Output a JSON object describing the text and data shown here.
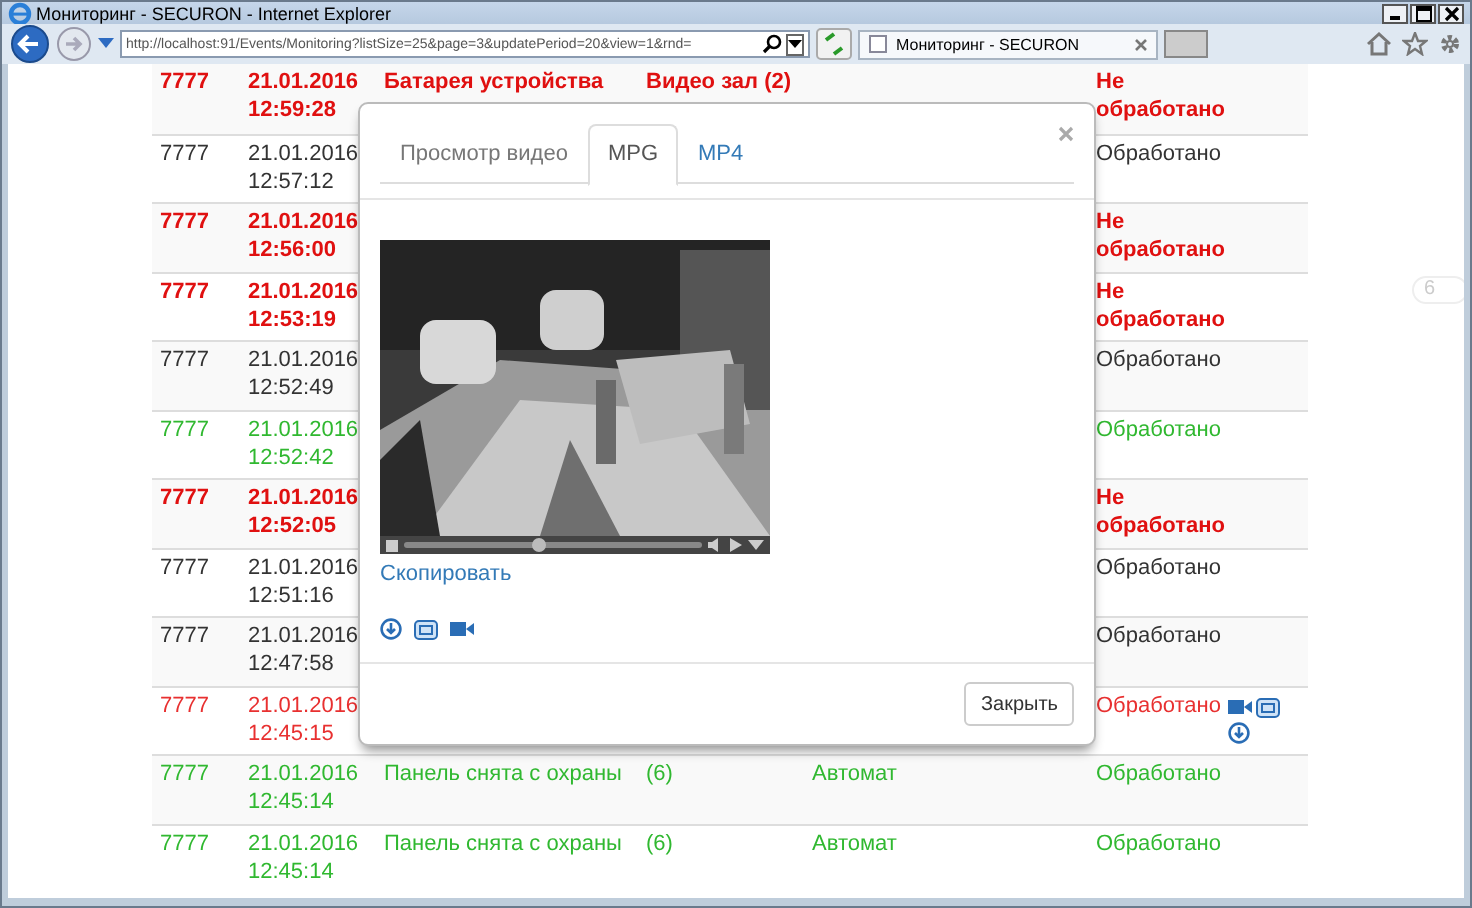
{
  "window": {
    "title": "Мониторинг - SECURON - Internet Explorer"
  },
  "browser": {
    "address": "http://localhost:91/Events/Monitoring?listSize=25&page=3&updatePeriod=20&view=1&rnd=",
    "tabs": [
      {
        "label": "Мониторинг - SECURON",
        "selected": true
      }
    ]
  },
  "events": [
    {
      "kind": "alarm",
      "code": "7777",
      "date": "21.01.2016",
      "time": "12:59:28",
      "event": "Батарея устройства",
      "zone": "Видео зал (2)",
      "status": "Не обработано",
      "media": false
    },
    {
      "kind": "normal",
      "code": "7777",
      "date": "21.01.2016",
      "time": "12:57:12",
      "status": "Обработано",
      "media": false
    },
    {
      "kind": "alarm",
      "code": "7777",
      "date": "21.01.2016",
      "time": "12:56:00",
      "status": "Не обработано",
      "media": false
    },
    {
      "kind": "alarm",
      "code": "7777",
      "date": "21.01.2016",
      "time": "12:53:19",
      "status": "Не обработано",
      "media": false
    },
    {
      "kind": "normal",
      "code": "7777",
      "date": "21.01.2016",
      "time": "12:52:49",
      "status": "Обработано",
      "media": false
    },
    {
      "kind": "ok",
      "code": "7777",
      "date": "21.01.2016",
      "time": "12:52:42",
      "status": "Обработано",
      "media": false
    },
    {
      "kind": "alarm",
      "code": "7777",
      "date": "21.01.2016",
      "time": "12:52:05",
      "status": "Не обработано",
      "media": false
    },
    {
      "kind": "normal",
      "code": "7777",
      "date": "21.01.2016",
      "time": "12:51:16",
      "status": "Обработано",
      "media": false
    },
    {
      "kind": "normal",
      "code": "7777",
      "date": "21.01.2016",
      "time": "12:47:58",
      "status": "Обработано",
      "media": false
    },
    {
      "kind": "restored",
      "code": "7777",
      "date": "21.01.2016",
      "time": "12:45:15",
      "status": "Обработано",
      "media": true
    },
    {
      "kind": "ok",
      "code": "7777",
      "date": "21.01.2016",
      "time": "12:45:14",
      "event": "Панель снята с охраны",
      "zone": "(6)",
      "user": "Автомат",
      "status": "Обработано",
      "media": false
    },
    {
      "kind": "ok",
      "code": "7777",
      "date": "21.01.2016",
      "time": "12:45:14",
      "event": "Панель снята с охраны",
      "zone": "(6)",
      "user": "Автомат",
      "status": "Обработано",
      "media": false
    }
  ],
  "side_badge": "6",
  "modal": {
    "tabs": [
      {
        "label": "Просмотр видео",
        "selected": false,
        "disabled": true
      },
      {
        "label": "MPG",
        "selected": true,
        "disabled": false
      },
      {
        "label": "MP4",
        "selected": false,
        "disabled": false
      }
    ],
    "video": {
      "level": 0.45
    },
    "copy_link": "Скопировать",
    "close_button": "Закрыть"
  }
}
